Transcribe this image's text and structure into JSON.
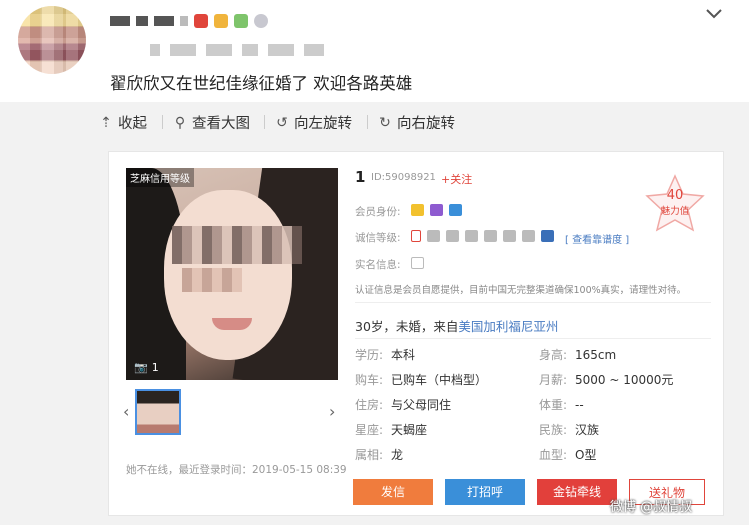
{
  "post": {
    "text": "翟欣欣又在世纪佳缘征婚了 欢迎各路英雄"
  },
  "toolbar": {
    "collapse": "收起",
    "view_large": "查看大图",
    "rotate_left": "向左旋转",
    "rotate_right": "向右旋转"
  },
  "profile": {
    "photo_tag": "芝麻信用等级",
    "photo_count": "1",
    "name": "1",
    "id": "ID:59098921",
    "follow": "+关注",
    "charm_value": "40",
    "charm_label": "魅力值",
    "member_label": "会员身份:",
    "trust_label": "诚信等级:",
    "trust_link": "[ 查看靠谱度 ]",
    "real_info_label": "实名信息:",
    "disclaimer": "认证信息是会员自愿提供，目前中国无完整渠道确保100%真实，请理性对待。",
    "summary_prefix": "30岁，未婚，来自",
    "summary_location": "美国加利福尼亚州",
    "fields": [
      {
        "k": "学历:",
        "v": "本科"
      },
      {
        "k": "身高:",
        "v": "165cm"
      },
      {
        "k": "购车:",
        "v": "已购车（中档型）"
      },
      {
        "k": "月薪:",
        "v": "5000 ~ 10000元"
      },
      {
        "k": "住房:",
        "v": "与父母同住"
      },
      {
        "k": "体重:",
        "v": "--"
      },
      {
        "k": "星座:",
        "v": "天蝎座"
      },
      {
        "k": "民族:",
        "v": "汉族"
      },
      {
        "k": "属相:",
        "v": "龙"
      },
      {
        "k": "血型:",
        "v": "O型"
      }
    ],
    "last_login": "她不在线，最近登录时间：2019-05-15 08:39",
    "buttons": {
      "message": "发信",
      "greet": "打招呼",
      "diamond": "金钻牵线",
      "gift": "送礼物"
    }
  },
  "watermark": "微博 @叔情叔",
  "colors": {
    "accent_red": "#e0453b",
    "link_blue": "#4a7cc2",
    "btn_orange": "#f07c3d",
    "btn_blue": "#3a8fd9",
    "btn_red": "#e2403b"
  }
}
